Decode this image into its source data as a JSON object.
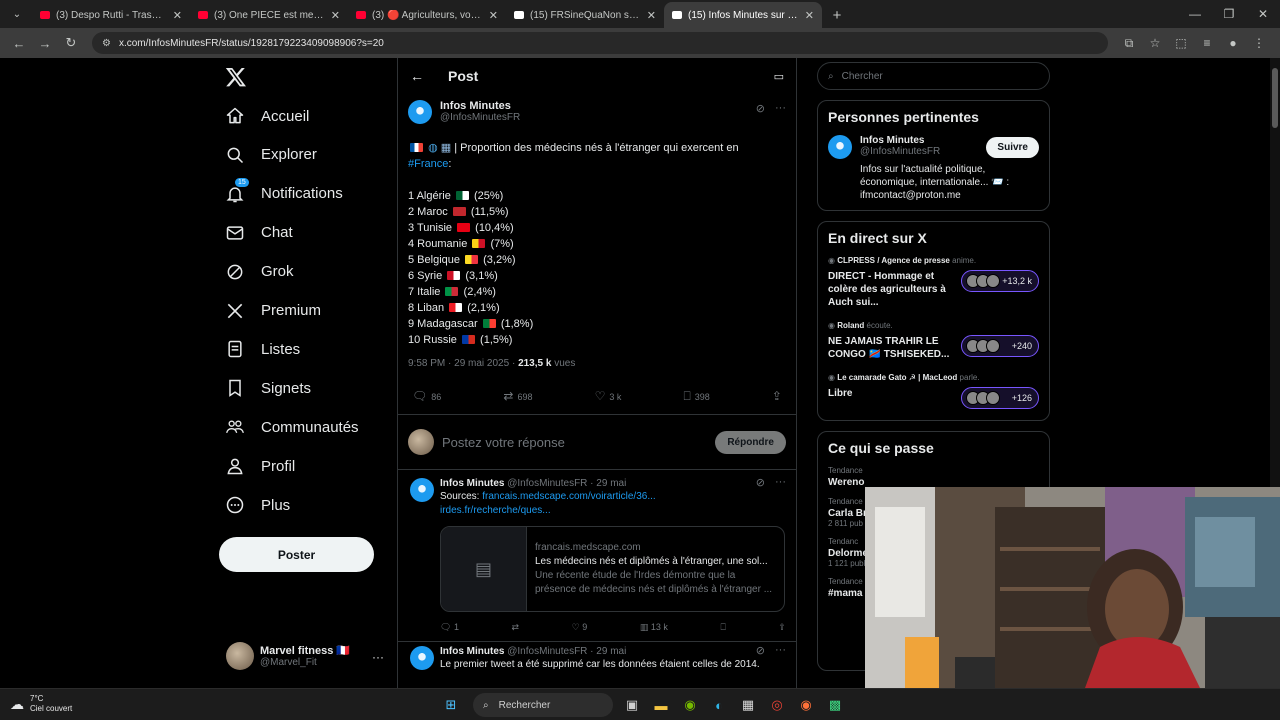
{
  "browser": {
    "tabs": [
      {
        "title": "(3) Despo Rutti - Trashhh - YouTube",
        "color": "#ff0033",
        "active": false
      },
      {
        "title": "(3) One PIECE est meilleur sans ...",
        "color": "#ff0033",
        "active": false
      },
      {
        "title": "(3) 🔴 Agriculteurs, vote du budget...",
        "color": "#ff0033",
        "active": false
      },
      {
        "title": "(15) FRSineQuaNon sur X : \"@T...",
        "color": "#ffffff",
        "active": false
      },
      {
        "title": "(15) Infos Minutes sur X : \"🇫🇷 🌍",
        "color": "#ffffff",
        "active": true
      }
    ],
    "url": "x.com/InfosMinutesFR/status/1928179223409098906?s=20"
  },
  "nav": {
    "items": [
      {
        "label": "Accueil",
        "icon": "home-icon"
      },
      {
        "label": "Explorer",
        "icon": "search-icon"
      },
      {
        "label": "Notifications",
        "icon": "bell-icon",
        "badge": "15"
      },
      {
        "label": "Chat",
        "icon": "mail-icon"
      },
      {
        "label": "Grok",
        "icon": "grok-icon"
      },
      {
        "label": "Premium",
        "icon": "x-icon"
      },
      {
        "label": "Listes",
        "icon": "list-icon"
      },
      {
        "label": "Signets",
        "icon": "bookmark-icon"
      },
      {
        "label": "Communautés",
        "icon": "communities-icon"
      },
      {
        "label": "Profil",
        "icon": "person-icon"
      },
      {
        "label": "Plus",
        "icon": "more-icon"
      }
    ],
    "post_button": "Poster",
    "user": {
      "name": "Marvel fitness 🇫🇷",
      "handle": "@Marvel_Fit"
    }
  },
  "post": {
    "header_title": "Post",
    "author_name": "Infos Minutes",
    "author_handle": "@InfosMinutesFR",
    "intro": "| Proportion des médecins nés à l'étranger qui exercent en",
    "hashtag": "#France",
    "hashtag_suffix": ":",
    "list": [
      {
        "rank": "1 Algérie",
        "pct": "(25%)",
        "flag": [
          "#006233",
          "#ffffff"
        ]
      },
      {
        "rank": "2 Maroc",
        "pct": "(11,5%)",
        "flag": [
          "#c1272d",
          "#c1272d"
        ]
      },
      {
        "rank": "3 Tunisie",
        "pct": "(10,4%)",
        "flag": [
          "#e70013",
          "#e70013"
        ]
      },
      {
        "rank": "4 Roumanie",
        "pct": "(7%)",
        "flag": [
          "#fcd116",
          "#ce1126"
        ]
      },
      {
        "rank": "5 Belgique",
        "pct": "(3,2%)",
        "flag": [
          "#fdda24",
          "#ef3340"
        ]
      },
      {
        "rank": "6 Syrie",
        "pct": "(3,1%)",
        "flag": [
          "#ce1126",
          "#ffffff"
        ]
      },
      {
        "rank": "7 Italie",
        "pct": "(2,4%)",
        "flag": [
          "#009246",
          "#ce2b37"
        ]
      },
      {
        "rank": "8 Liban",
        "pct": "(2,1%)",
        "flag": [
          "#ed1c24",
          "#ffffff"
        ]
      },
      {
        "rank": "9 Madagascar",
        "pct": "(1,8%)",
        "flag": [
          "#007e3a",
          "#fc3d32"
        ]
      },
      {
        "rank": "10 Russie",
        "pct": "(1,5%)",
        "flag": [
          "#0039a6",
          "#d52b1e"
        ]
      }
    ],
    "time": "9:58 PM · 29 mai 2025 · ",
    "views": "213,5 k",
    "views_label": " vues",
    "stats": {
      "replies": "86",
      "reposts": "698",
      "likes": "3 k",
      "bookmarks": "398"
    },
    "reply_placeholder": "Postez votre réponse",
    "reply_button": "Répondre"
  },
  "replies": [
    {
      "name": "Infos Minutes",
      "meta": " @InfosMinutesFR · 29 mai",
      "text": "Sources: ",
      "link1": "francais.medscape.com/voirarticle/36...",
      "link2": "irdes.fr/recherche/ques...",
      "card": {
        "domain": "francais.medscape.com",
        "title": "Les médecins nés et diplômés à l'étranger, une sol...",
        "desc": "Une récente étude de l'Irdes démontre que la présence de médecins nés et diplômés à l'étranger ..."
      },
      "stats": {
        "replies": "1",
        "likes": "9",
        "views": "13 k"
      }
    },
    {
      "name": "Infos Minutes",
      "meta": " @InfosMinutesFR · 29 mai",
      "text": "Le premier tweet a été supprimé car les données étaient celles de 2014."
    }
  ],
  "sidebar": {
    "search_placeholder": "Chercher",
    "relevant": {
      "title": "Personnes pertinentes",
      "name": "Infos Minutes",
      "handle": "@InfosMinutesFR",
      "follow": "Suivre",
      "bio": "Infos sur l'actualité politique, économique, internationale... 📨 : ifmcontact@proton.me"
    },
    "live": {
      "title": "En direct sur X",
      "items": [
        {
          "host": "CLPRESS / Agence de presse",
          "verb": " anime.",
          "title": "DIRECT - Hommage et colère des agriculteurs à Auch sui...",
          "count": "+13,2 k"
        },
        {
          "host": "Roland",
          "verb": " écoute.",
          "title": "NE JAMAIS TRAHIR LE CONGO 🇨🇩 TSHISEKED...",
          "count": "+240"
        },
        {
          "host": "Le camarade Gato ☭ | MacLeod",
          "verb": " parle.",
          "title": "Libre",
          "count": "+126"
        }
      ]
    },
    "happening": {
      "title": "Ce qui se passe",
      "trends": [
        {
          "label": "Tendance",
          "name": "Wereno"
        },
        {
          "label": "Tendance",
          "name": "Carla Br",
          "count": "2 811 pub"
        },
        {
          "label": "Tendanc",
          "name": "Delorme",
          "count": "1 121 publ"
        },
        {
          "label": "Tendance",
          "name": "#mama"
        }
      ]
    }
  },
  "taskbar": {
    "temp": "7°C",
    "weather": "Ciel couvert",
    "search": "Rechercher"
  }
}
